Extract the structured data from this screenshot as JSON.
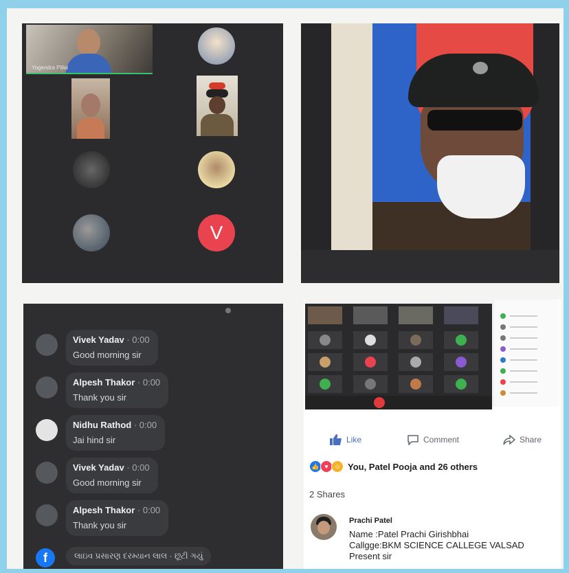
{
  "panel1": {
    "main_participant_name": "Yogendra Pillai",
    "v_avatar_letter": "V"
  },
  "panel3": {
    "topbar_text": "",
    "comments": [
      {
        "name": "Vivek Yadav",
        "time": "0:00",
        "message": "Good morning sir"
      },
      {
        "name": "Alpesh Thakor",
        "time": "0:00",
        "message": "Thank you sir"
      },
      {
        "name": "Nidhu Rathod",
        "time": "0:00",
        "message": "Jai hind sir"
      },
      {
        "name": "Vivek Yadav",
        "time": "0:00",
        "message": "Good morning sir"
      },
      {
        "name": "Alpesh Thakor",
        "time": "0:00",
        "message": "Thank you sir"
      }
    ],
    "live_notice": "લાઇવ પ્રસારણ દરમ્યાન લાલ · છૂટી ગયું",
    "fb_icon": "f"
  },
  "post": {
    "like_label": "Like",
    "comment_label": "Comment",
    "share_label": "Share",
    "reactions_text": "You, Patel Pooja and 26 others",
    "shares_text": "2 Shares",
    "comment": {
      "author": "Prachi Patel",
      "line1": "Name :Patel Prachi Girishbhai",
      "line2": "Callgge:BKM SCIENCE CALLEGE VALSAD",
      "line3": "Present sir"
    }
  },
  "colors": {
    "frame": "#8fd0ea",
    "video_bg": "#2b2b2e",
    "v_avatar": "#e8434e",
    "active_border": "#39c46b",
    "facebook_blue": "#1877f2",
    "like_blue": "#4b6fbf"
  }
}
